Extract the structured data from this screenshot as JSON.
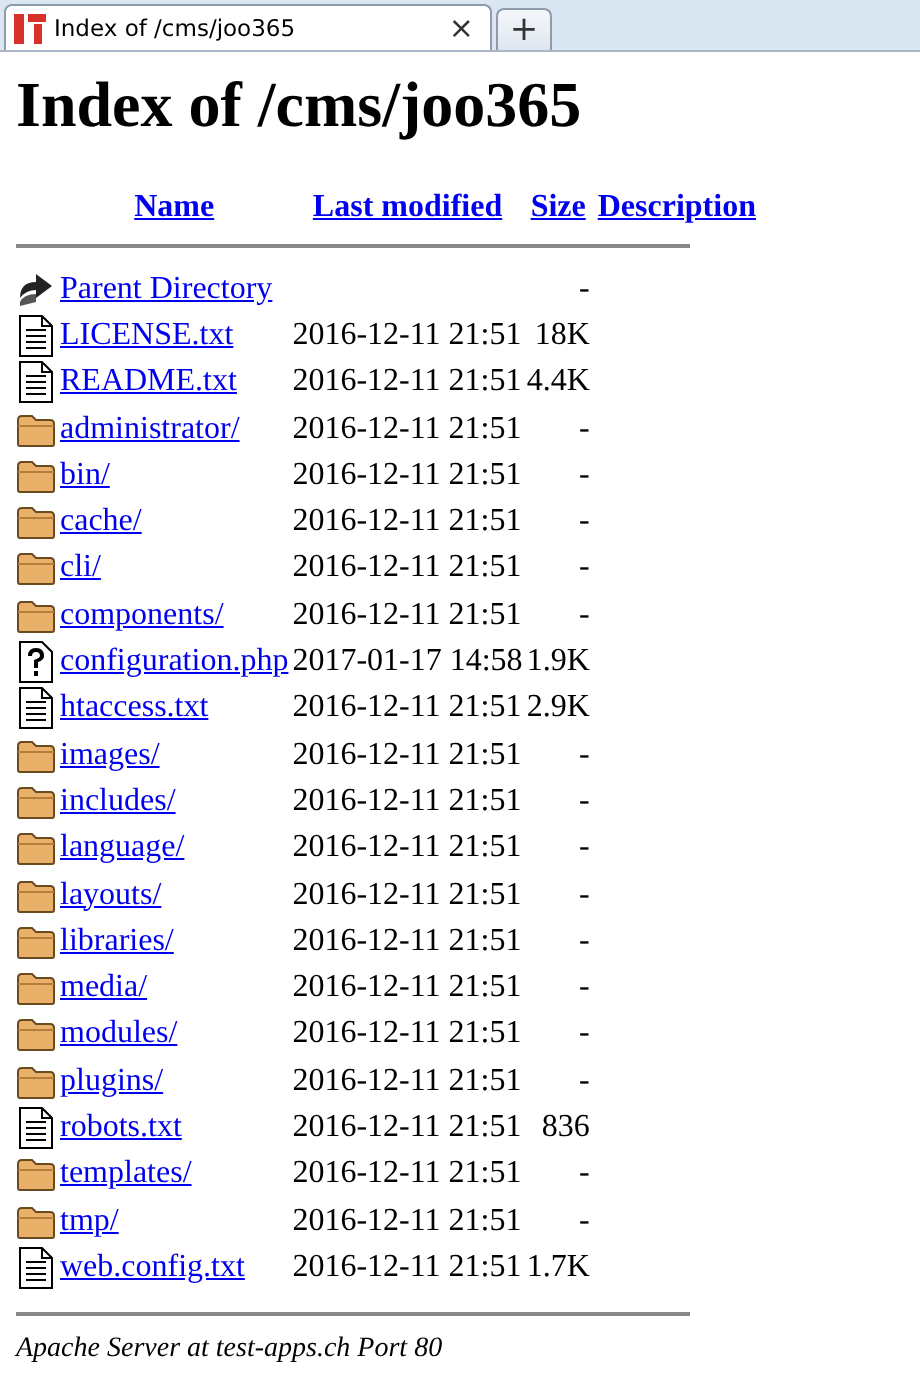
{
  "tab": {
    "title": "Index of /cms/joo365",
    "close": "×",
    "new_tab": "+"
  },
  "heading": "Index of /cms/joo365",
  "columns": [
    {
      "label": "Name"
    },
    {
      "label": "Last modified"
    },
    {
      "label": "Size"
    },
    {
      "label": "Description"
    }
  ],
  "rows": [
    {
      "kind": "back",
      "name": "Parent Directory",
      "modified": "",
      "size": "-"
    },
    {
      "kind": "text",
      "name": "LICENSE.txt",
      "modified": "2016-12-11 21:51",
      "size": "18K"
    },
    {
      "kind": "text",
      "name": "README.txt",
      "modified": "2016-12-11 21:51",
      "size": "4.4K"
    },
    {
      "kind": "folder",
      "name": "administrator/",
      "modified": "2016-12-11 21:51",
      "size": "-"
    },
    {
      "kind": "folder",
      "name": "bin/",
      "modified": "2016-12-11 21:51",
      "size": "-"
    },
    {
      "kind": "folder",
      "name": "cache/",
      "modified": "2016-12-11 21:51",
      "size": "-"
    },
    {
      "kind": "folder",
      "name": "cli/",
      "modified": "2016-12-11 21:51",
      "size": "-"
    },
    {
      "kind": "folder",
      "name": "components/",
      "modified": "2016-12-11 21:51",
      "size": "-"
    },
    {
      "kind": "unknown",
      "name": "configuration.php",
      "modified": "2017-01-17 14:58",
      "size": "1.9K"
    },
    {
      "kind": "text",
      "name": "htaccess.txt",
      "modified": "2016-12-11 21:51",
      "size": "2.9K"
    },
    {
      "kind": "folder",
      "name": "images/",
      "modified": "2016-12-11 21:51",
      "size": "-"
    },
    {
      "kind": "folder",
      "name": "includes/",
      "modified": "2016-12-11 21:51",
      "size": "-"
    },
    {
      "kind": "folder",
      "name": "language/",
      "modified": "2016-12-11 21:51",
      "size": "-"
    },
    {
      "kind": "folder",
      "name": "layouts/",
      "modified": "2016-12-11 21:51",
      "size": "-"
    },
    {
      "kind": "folder",
      "name": "libraries/",
      "modified": "2016-12-11 21:51",
      "size": "-"
    },
    {
      "kind": "folder",
      "name": "media/",
      "modified": "2016-12-11 21:51",
      "size": "-"
    },
    {
      "kind": "folder",
      "name": "modules/",
      "modified": "2016-12-11 21:51",
      "size": "-"
    },
    {
      "kind": "folder",
      "name": "plugins/",
      "modified": "2016-12-11 21:51",
      "size": "-"
    },
    {
      "kind": "text",
      "name": "robots.txt",
      "modified": "2016-12-11 21:51",
      "size": "836"
    },
    {
      "kind": "folder",
      "name": "templates/",
      "modified": "2016-12-11 21:51",
      "size": "-"
    },
    {
      "kind": "folder",
      "name": "tmp/",
      "modified": "2016-12-11 21:51",
      "size": "-"
    },
    {
      "kind": "text",
      "name": "web.config.txt",
      "modified": "2016-12-11 21:51",
      "size": "1.7K"
    }
  ],
  "footer": "Apache Server at test-apps.ch Port 80"
}
